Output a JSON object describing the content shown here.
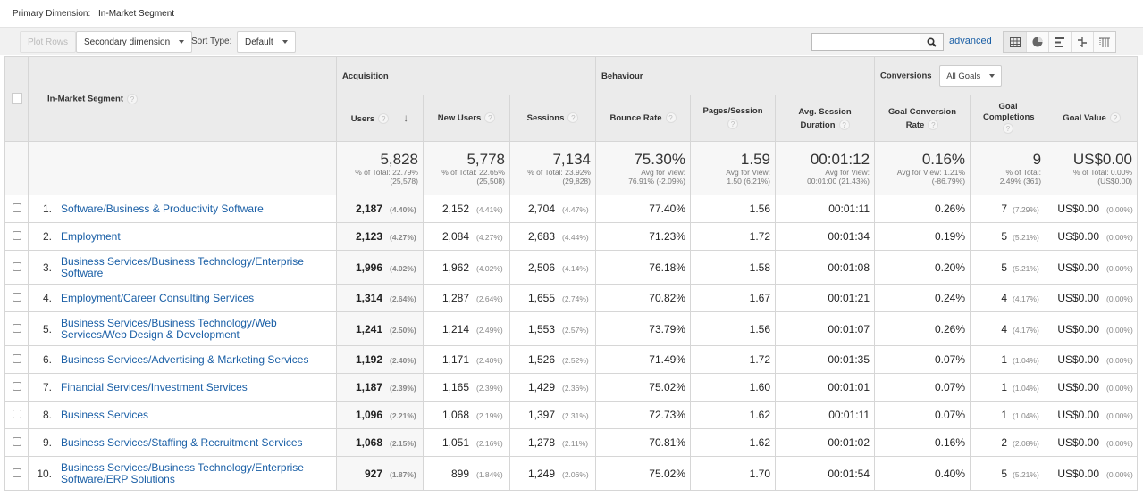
{
  "primary_dimension": {
    "label": "Primary Dimension:",
    "value": "In-Market Segment"
  },
  "toolbar": {
    "plot_rows": "Plot Rows",
    "secondary_dimension": "Secondary dimension",
    "sort_type_label": "Sort Type:",
    "sort_type_value": "Default",
    "search_placeholder": "",
    "advanced": "advanced",
    "view_icons": [
      "table-view-icon",
      "pie-view-icon",
      "bar-view-icon",
      "comparison-view-icon",
      "pivot-view-icon"
    ]
  },
  "table": {
    "dimension_header": "In-Market Segment",
    "groups": {
      "acquisition": "Acquisition",
      "behaviour": "Behaviour",
      "conversions": "Conversions",
      "goal_select": "All Goals"
    },
    "columns": {
      "users": "Users",
      "new_users": "New Users",
      "sessions": "Sessions",
      "bounce_rate": "Bounce Rate",
      "pages_session": "Pages/Session",
      "avg_session_duration": "Avg. Session Duration",
      "goal_conversion_rate": "Goal Conversion Rate",
      "goal_completions": "Goal Completions",
      "goal_value": "Goal Value"
    },
    "totals": {
      "users": {
        "value": "5,828",
        "sub1": "% of Total: 22.79%",
        "sub2": "(25,578)"
      },
      "new_users": {
        "value": "5,778",
        "sub1": "% of Total: 22.65%",
        "sub2": "(25,508)"
      },
      "sessions": {
        "value": "7,134",
        "sub1": "% of Total: 23.92%",
        "sub2": "(29,828)"
      },
      "bounce_rate": {
        "value": "75.30%",
        "sub1": "Avg for View:",
        "sub2": "76.91% (-2.09%)"
      },
      "pages_session": {
        "value": "1.59",
        "sub1": "Avg for View:",
        "sub2": "1.50 (6.21%)"
      },
      "avg_session_duration": {
        "value": "00:01:12",
        "sub1": "Avg for View:",
        "sub2": "00:01:00 (21.43%)"
      },
      "goal_conversion_rate": {
        "value": "0.16%",
        "sub1": "Avg for View: 1.21%",
        "sub2": "(-86.79%)"
      },
      "goal_completions": {
        "value": "9",
        "sub1": "% of Total:",
        "sub2": "2.49% (361)"
      },
      "goal_value": {
        "value": "US$0.00",
        "sub1": "% of Total: 0.00%",
        "sub2": "(US$0.00)"
      }
    },
    "rows": [
      {
        "n": "1.",
        "segment": "Software/Business & Productivity Software",
        "users": "2,187",
        "users_pct": "(4.40%)",
        "new_users": "2,152",
        "new_users_pct": "(4.41%)",
        "sessions": "2,704",
        "sessions_pct": "(4.47%)",
        "bounce_rate": "77.40%",
        "pages_session": "1.56",
        "duration": "00:01:11",
        "conv_rate": "0.26%",
        "completions": "7",
        "completions_pct": "(7.29%)",
        "goal_value": "US$0.00",
        "goal_value_pct": "(0.00%)"
      },
      {
        "n": "2.",
        "segment": "Employment",
        "users": "2,123",
        "users_pct": "(4.27%)",
        "new_users": "2,084",
        "new_users_pct": "(4.27%)",
        "sessions": "2,683",
        "sessions_pct": "(4.44%)",
        "bounce_rate": "71.23%",
        "pages_session": "1.72",
        "duration": "00:01:34",
        "conv_rate": "0.19%",
        "completions": "5",
        "completions_pct": "(5.21%)",
        "goal_value": "US$0.00",
        "goal_value_pct": "(0.00%)"
      },
      {
        "n": "3.",
        "segment": "Business Services/Business Technology/Enterprise Software",
        "users": "1,996",
        "users_pct": "(4.02%)",
        "new_users": "1,962",
        "new_users_pct": "(4.02%)",
        "sessions": "2,506",
        "sessions_pct": "(4.14%)",
        "bounce_rate": "76.18%",
        "pages_session": "1.58",
        "duration": "00:01:08",
        "conv_rate": "0.20%",
        "completions": "5",
        "completions_pct": "(5.21%)",
        "goal_value": "US$0.00",
        "goal_value_pct": "(0.00%)"
      },
      {
        "n": "4.",
        "segment": "Employment/Career Consulting Services",
        "users": "1,314",
        "users_pct": "(2.64%)",
        "new_users": "1,287",
        "new_users_pct": "(2.64%)",
        "sessions": "1,655",
        "sessions_pct": "(2.74%)",
        "bounce_rate": "70.82%",
        "pages_session": "1.67",
        "duration": "00:01:21",
        "conv_rate": "0.24%",
        "completions": "4",
        "completions_pct": "(4.17%)",
        "goal_value": "US$0.00",
        "goal_value_pct": "(0.00%)"
      },
      {
        "n": "5.",
        "segment": "Business Services/Business Technology/Web Services/Web Design & Development",
        "users": "1,241",
        "users_pct": "(2.50%)",
        "new_users": "1,214",
        "new_users_pct": "(2.49%)",
        "sessions": "1,553",
        "sessions_pct": "(2.57%)",
        "bounce_rate": "73.79%",
        "pages_session": "1.56",
        "duration": "00:01:07",
        "conv_rate": "0.26%",
        "completions": "4",
        "completions_pct": "(4.17%)",
        "goal_value": "US$0.00",
        "goal_value_pct": "(0.00%)"
      },
      {
        "n": "6.",
        "segment": "Business Services/Advertising & Marketing Services",
        "users": "1,192",
        "users_pct": "(2.40%)",
        "new_users": "1,171",
        "new_users_pct": "(2.40%)",
        "sessions": "1,526",
        "sessions_pct": "(2.52%)",
        "bounce_rate": "71.49%",
        "pages_session": "1.72",
        "duration": "00:01:35",
        "conv_rate": "0.07%",
        "completions": "1",
        "completions_pct": "(1.04%)",
        "goal_value": "US$0.00",
        "goal_value_pct": "(0.00%)"
      },
      {
        "n": "7.",
        "segment": "Financial Services/Investment Services",
        "users": "1,187",
        "users_pct": "(2.39%)",
        "new_users": "1,165",
        "new_users_pct": "(2.39%)",
        "sessions": "1,429",
        "sessions_pct": "(2.36%)",
        "bounce_rate": "75.02%",
        "pages_session": "1.60",
        "duration": "00:01:01",
        "conv_rate": "0.07%",
        "completions": "1",
        "completions_pct": "(1.04%)",
        "goal_value": "US$0.00",
        "goal_value_pct": "(0.00%)"
      },
      {
        "n": "8.",
        "segment": "Business Services",
        "users": "1,096",
        "users_pct": "(2.21%)",
        "new_users": "1,068",
        "new_users_pct": "(2.19%)",
        "sessions": "1,397",
        "sessions_pct": "(2.31%)",
        "bounce_rate": "72.73%",
        "pages_session": "1.62",
        "duration": "00:01:11",
        "conv_rate": "0.07%",
        "completions": "1",
        "completions_pct": "(1.04%)",
        "goal_value": "US$0.00",
        "goal_value_pct": "(0.00%)"
      },
      {
        "n": "9.",
        "segment": "Business Services/Staffing & Recruitment Services",
        "users": "1,068",
        "users_pct": "(2.15%)",
        "new_users": "1,051",
        "new_users_pct": "(2.16%)",
        "sessions": "1,278",
        "sessions_pct": "(2.11%)",
        "bounce_rate": "70.81%",
        "pages_session": "1.62",
        "duration": "00:01:02",
        "conv_rate": "0.16%",
        "completions": "2",
        "completions_pct": "(2.08%)",
        "goal_value": "US$0.00",
        "goal_value_pct": "(0.00%)"
      },
      {
        "n": "10.",
        "segment": "Business Services/Business Technology/Enterprise Software/ERP Solutions",
        "users": "927",
        "users_pct": "(1.87%)",
        "new_users": "899",
        "new_users_pct": "(1.84%)",
        "sessions": "1,249",
        "sessions_pct": "(2.06%)",
        "bounce_rate": "75.02%",
        "pages_session": "1.70",
        "duration": "00:01:54",
        "conv_rate": "0.40%",
        "completions": "5",
        "completions_pct": "(5.21%)",
        "goal_value": "US$0.00",
        "goal_value_pct": "(0.00%)"
      }
    ]
  }
}
